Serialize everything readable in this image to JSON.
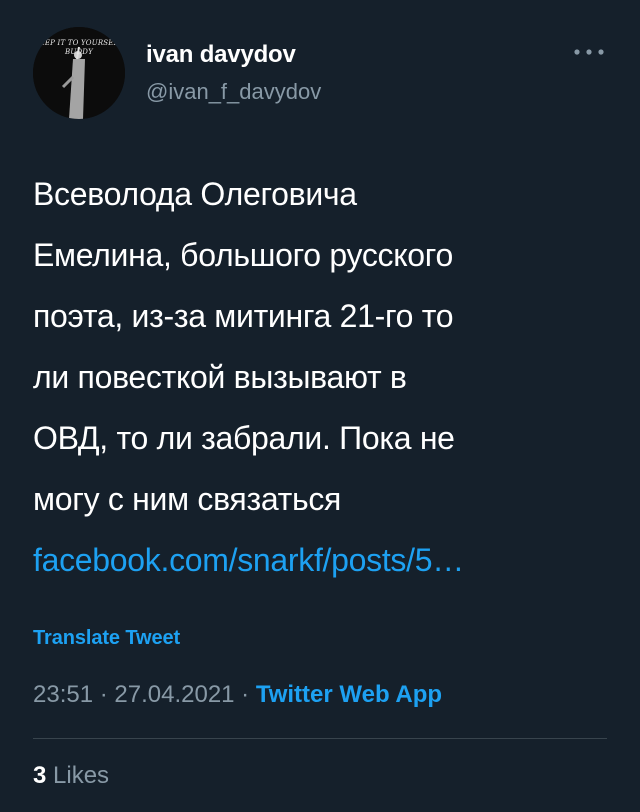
{
  "user": {
    "avatar_text": [
      "EEP IT TO YOURSEL",
      "BUDDY"
    ],
    "name": "ivan davydov",
    "handle": "@ivan_f_davydov"
  },
  "tweet": {
    "lines": [
      "Всеволода Олеговича",
      "Емелина, большого русского",
      "поэта, из-за митинга 21-го то",
      "ли повесткой вызывают в",
      "ОВД, то ли забрали. Пока не",
      "могу с ним связаться"
    ],
    "link_text": "facebook.com/snarkf/posts/5…"
  },
  "translate_label": "Translate Tweet",
  "meta": {
    "time": "23:51",
    "sep1": " · ",
    "date": "27.04.2021",
    "sep2": " · ",
    "app": "Twitter Web App"
  },
  "likes": {
    "count": "3",
    "label": "Likes"
  },
  "icons": {
    "more": "more-horizontal-icon"
  },
  "colors": {
    "background": "#15202b",
    "text": "#ffffff",
    "secondary": "#8899a6",
    "accent": "#1da1f2",
    "divider": "#38444d"
  }
}
